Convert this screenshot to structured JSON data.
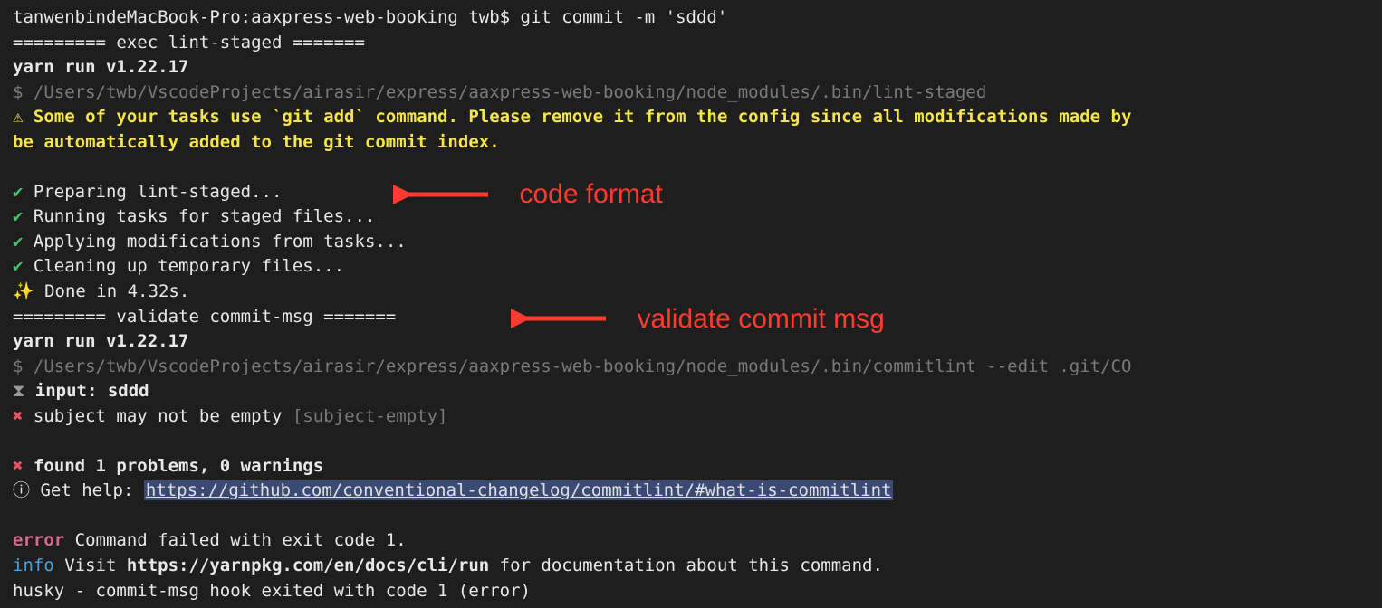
{
  "prompt": {
    "host": "tanwenbindeMacBook-Pro:aaxpress-web-booking",
    "user": " twb$ ",
    "cmd": "git commit -m 'sddd'"
  },
  "sections": {
    "lintHeader": "========= exec lint-staged =======",
    "validateHeader": "========= validate commit-msg ======="
  },
  "yarn": {
    "run": "yarn run v1.22.17",
    "dollar": "$ ",
    "lintPath": "/Users/twb/VscodeProjects/airasir/express/aaxpress-web-booking/node_modules/.bin/lint-staged",
    "commitlintPath": "/Users/twb/VscodeProjects/airasir/express/aaxpress-web-booking/node_modules/.bin/commitlint --edit .git/CO"
  },
  "warning": {
    "icon": "⚠",
    "line1": " Some of your tasks use `git add` command. Please remove it from the config since all modifications made by",
    "line2": "be automatically added to the git commit index."
  },
  "tasks": {
    "check": "✔",
    "t1": " Preparing lint-staged...",
    "t2": " Running tasks for staged files...",
    "t3": " Applying modifications from tasks...",
    "t4": " Cleaning up temporary files...",
    "sparkle": "✨",
    "done": "  Done in 4.32s."
  },
  "commitlint": {
    "inputIcon": "⧗",
    "inputLabel": "   input: ",
    "inputValue": "sddd",
    "errIcon": "✖",
    "errMsg": "   subject may not be empty ",
    "errRule": "[subject-empty]",
    "summary": "   found 1 problems, 0 warnings",
    "helpIcon": "ⓘ",
    "helpLabel": "   Get help: ",
    "helpLink": "https://github.com/conventional-changelog/commitlint/#what-is-commitlint"
  },
  "tail": {
    "errorWord": "error",
    "errorMsg": " Command failed with exit code 1.",
    "infoWord": "info",
    "infoMsg1": " Visit ",
    "infoUrl": "https://yarnpkg.com/en/docs/cli/run",
    "infoMsg2": " for documentation about this command.",
    "husky": "husky - commit-msg hook exited with code 1 (error)"
  },
  "annotations": {
    "a1": "code format",
    "a2": "validate  commit msg"
  }
}
